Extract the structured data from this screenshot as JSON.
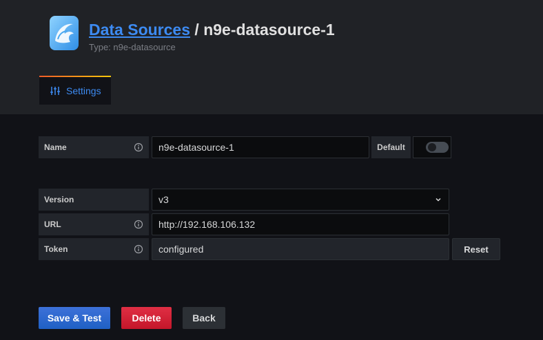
{
  "header": {
    "breadcrumb_link": "Data Sources",
    "separator": " / ",
    "title": "n9e-datasource-1",
    "subtitle": "Type: n9e-datasource",
    "logo_icon": "datasource-logo-icon"
  },
  "tabs": [
    {
      "label": "Settings",
      "icon": "sliders-icon",
      "active": true
    }
  ],
  "form": {
    "name": {
      "label": "Name",
      "value": "n9e-datasource-1"
    },
    "default": {
      "label": "Default",
      "enabled": false
    },
    "version": {
      "label": "Version",
      "value": "v3"
    },
    "url": {
      "label": "URL",
      "value": "http://192.168.106.132"
    },
    "token": {
      "label": "Token",
      "value": "configured",
      "reset_label": "Reset"
    }
  },
  "actions": {
    "save_label": "Save & Test",
    "delete_label": "Delete",
    "back_label": "Back"
  },
  "colors": {
    "accent": "#3d8bf2",
    "primary_button": "#1f60c4",
    "danger_button": "#c4162a",
    "background": "#111217",
    "header_background": "#202226"
  }
}
